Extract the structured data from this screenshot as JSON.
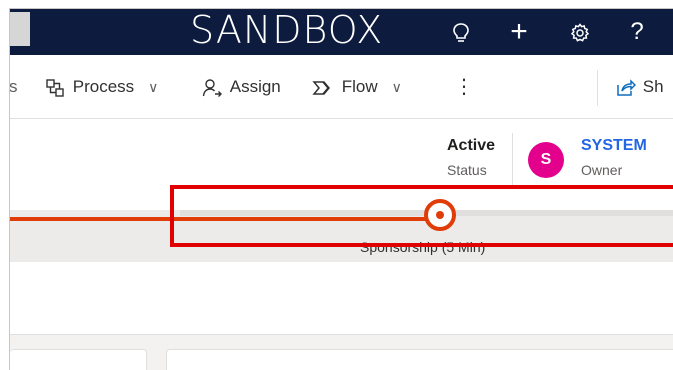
{
  "topbar": {
    "environment_label": "SANDBOX",
    "icons": [
      "lightbulb-icon",
      "plus-icon",
      "settings-icon",
      "help-icon"
    ],
    "help_glyph": "?",
    "plus_glyph": "+"
  },
  "command_bar": {
    "partial_left": "s",
    "process_label": "Process",
    "assign_label": "Assign",
    "flow_label": "Flow",
    "more_glyph": "⋮",
    "share_label": "Sh",
    "chevron_glyph": "∨"
  },
  "header": {
    "status_value": "Active",
    "status_label": "Status",
    "owner_initial": "S",
    "owner_name": "SYSTEM",
    "owner_label": "Owner"
  },
  "process_flow": {
    "active_stage_label": "Sponsorship  (5 Min)",
    "accent_color": "#e03c08"
  },
  "colors": {
    "topbar_bg": "#0d1b3e",
    "avatar_bg": "#e3008c",
    "owner_link": "#2266e3",
    "annotation": "#e00000"
  }
}
